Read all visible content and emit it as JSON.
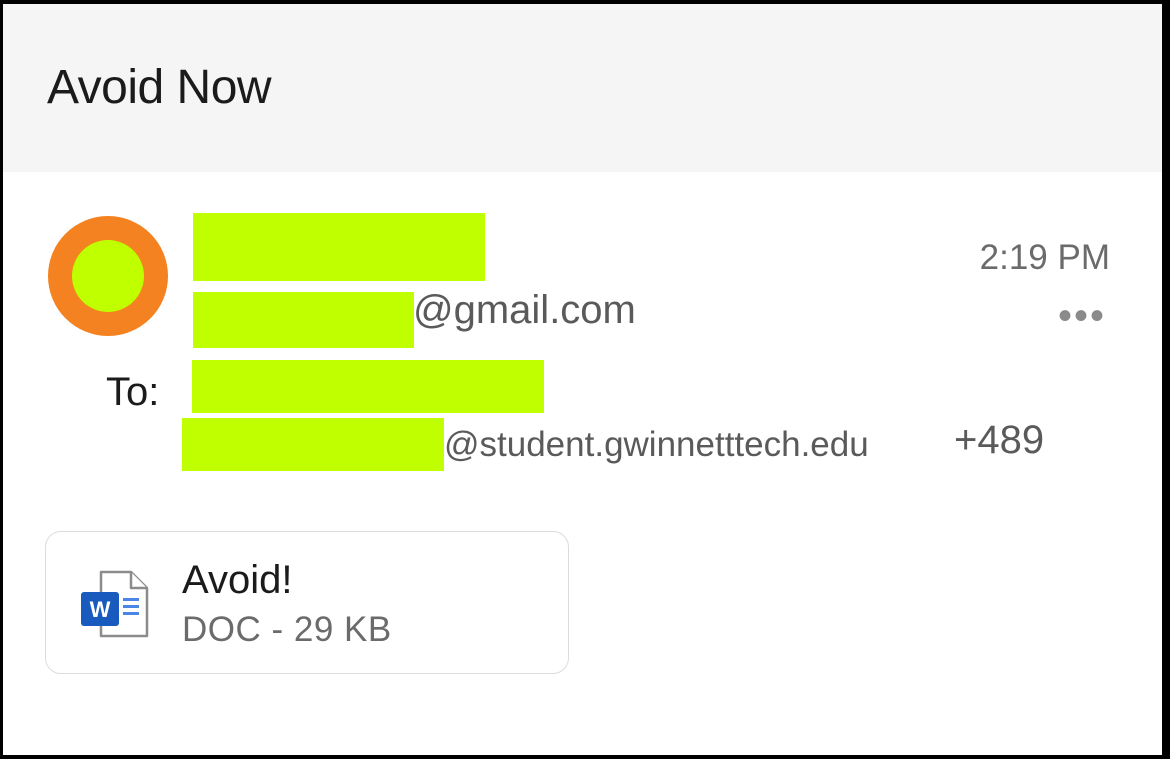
{
  "email": {
    "subject": "Avoid Now",
    "time": "2:19 PM",
    "more_icon": "•••",
    "sender": {
      "email_domain": "@gmail.com"
    },
    "to": {
      "label": "To:",
      "email_domain": "@student.gwinnetttech.edu",
      "more_count": "+489"
    },
    "attachment": {
      "name": "Avoid!",
      "meta": "DOC - 29 KB",
      "icon": "word-doc-icon"
    }
  },
  "colors": {
    "avatar_ring": "#f58220",
    "redaction": "#bfff00",
    "header_bg": "#f5f5f5",
    "word_blue": "#185abd"
  }
}
